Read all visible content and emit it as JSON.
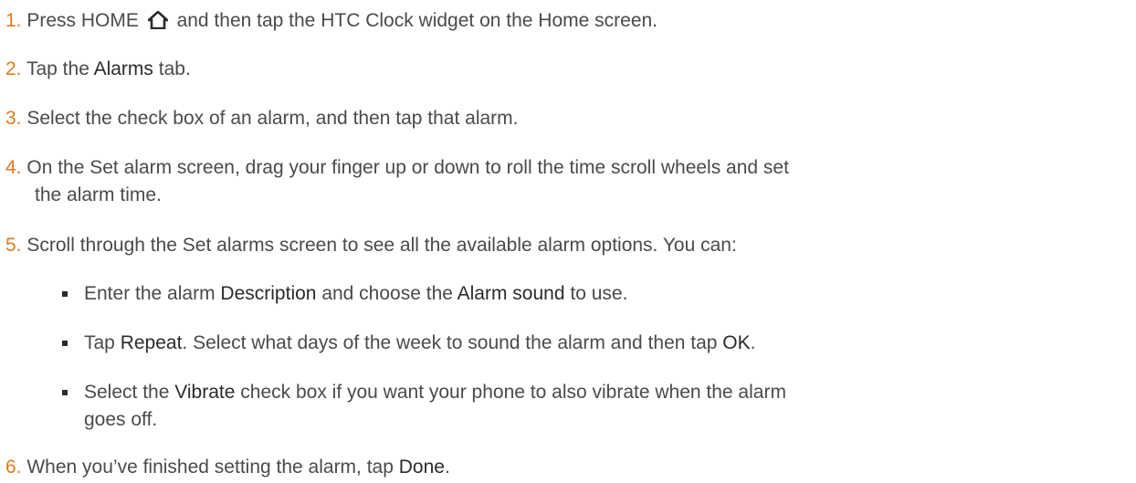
{
  "steps": [
    {
      "num": "1.",
      "a": "Press HOME",
      "b": "and then tap the HTC Clock widget on the Home screen."
    },
    {
      "num": "2.",
      "a": "Tap the",
      "b": "Alarms",
      "c": "tab."
    },
    {
      "num": "3.",
      "a": "Select the check box of an alarm, and then tap that alarm."
    },
    {
      "num": "4.",
      "a": "On the Set alarm screen, drag your finger up or down to roll the time scroll wheels and set",
      "b": "the alarm time."
    },
    {
      "num": "5.",
      "a": "Scroll through the Set alarms screen to see all the available alarm options. You can:"
    },
    {
      "num": "6.",
      "a": "When you’ve finished setting the alarm, tap",
      "b": "Done",
      "c": "."
    }
  ],
  "bullets": [
    {
      "a": "Enter the alarm",
      "b": "Description",
      "c": "and choose the",
      "d": "Alarm sound",
      "e": "to use."
    },
    {
      "a": "Tap",
      "b": "Repeat",
      "c": ". Select what days of the week to sound the alarm and then tap",
      "d": "OK",
      "e": "."
    },
    {
      "a": "Select the",
      "b": "Vibrate",
      "c": "check box if you want your phone to also vibrate when the alarm",
      "d": "goes off."
    }
  ],
  "icons": {
    "home": "home-icon"
  }
}
